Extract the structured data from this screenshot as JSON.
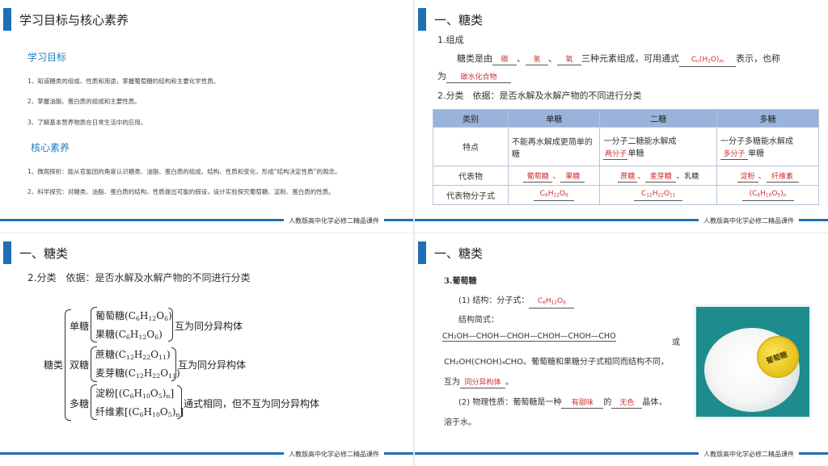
{
  "footer": "人教版高中化学必修二精品课件",
  "slide1": {
    "title": "学习目标与核心素养",
    "section1": "学习目标",
    "goals": [
      "1、知道糖类的组成、性质和用途，掌握葡萄糖的结构和主要化学性质。",
      "2、掌握油脂、蛋白质的组成和主要性质。",
      "3、了解基本营养物质在日常生活中的应用。"
    ],
    "section2": "核心素养",
    "literacy": [
      "1、微观探析：能从官能团的角度认识糖类、油脂、蛋白质的组成、结构、性质和变化，形成“结构决定性质”的观念。",
      "2、科学探究：对糖类、油脂、蛋白质的结构、性质提出可能的假设，设计实验探究葡萄糖、淀粉、蛋白质的性质。"
    ]
  },
  "slide2": {
    "title": "一、糖类",
    "composition_heading": "1.组成",
    "sentence": {
      "p1": "糖类是由",
      "blank1": "碳",
      "blank2": "氢",
      "blank3": "氧",
      "p2": "三种元素组成，可用通式",
      "p3": "表示，也称",
      "p4": "为",
      "blank5": "碳水化合物"
    },
    "classify_heading": "2.分类　依据：是否水解及水解产物的不同进行分类",
    "table": {
      "headers": [
        "类别",
        "单糖",
        "二糖",
        "多糖"
      ],
      "row_feature_label": "特点",
      "mono_feature": "不能再水解成更简单的糖",
      "di_feature": "一分子二糖能水解成",
      "di_blank": "两分子",
      "poly_feature": "一分子多糖能水解成",
      "poly_blank": "多分子",
      "unit_suffix": "单糖",
      "row_rep_label": "代表物",
      "mono_rep": [
        "葡萄糖",
        "果糖"
      ],
      "di_rep": [
        "蔗糖",
        "麦芽糖",
        "乳糖"
      ],
      "poly_rep": [
        "淀粉",
        "纤维素"
      ],
      "row_formula_label": "代表物分子式"
    }
  },
  "slide3": {
    "title": "一、糖类",
    "heading": "2.分类　依据：是否水解及水解产物的不同进行分类",
    "root": "糖类",
    "groups": [
      "单糖",
      "双糖",
      "多糖"
    ],
    "mono": [
      "葡萄糖",
      "果糖"
    ],
    "di": [
      "蔗糖",
      "麦芽糖"
    ],
    "poly": [
      "淀粉",
      "纤维素"
    ],
    "notes": [
      "互为同分异构体",
      "互为同分异构体",
      "通式相同，但不互为同分异构体"
    ]
  },
  "slide4": {
    "title": "一、糖类",
    "subtitle": "3.葡萄糖",
    "line1": "(1) 结构：分子式：",
    "line2": "结构简式：",
    "chain": "CH₂OH—CHOH—CHOH—CHOH—CHOH—CHO",
    "or": "或",
    "line3a": "CH₂OH(CHOH)₄CHO。葡萄糖和果糖分子式相同而结构不同，",
    "line4a": "互为",
    "isomer": "同分异构体",
    "line5a": "(2) 物理性质：葡萄糖是一种",
    "sweet": "有甜味",
    "de": "的",
    "color": "无色",
    "line5b": "晶体，",
    "line6": "溶于水。",
    "photo_label": "葡萄糖"
  }
}
